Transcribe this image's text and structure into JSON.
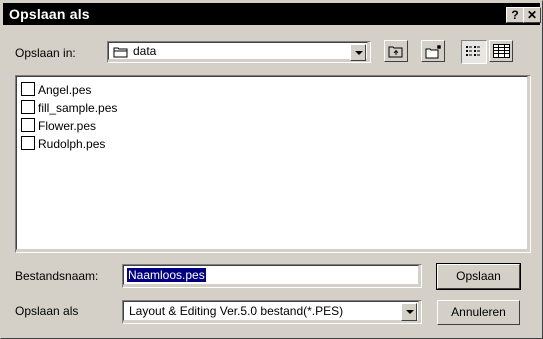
{
  "window": {
    "title": "Opslaan als",
    "help_label": "?",
    "close_label": "✕"
  },
  "location": {
    "label": "Opslaan in:",
    "value": "data"
  },
  "files": [
    {
      "name": "Angel.pes"
    },
    {
      "name": "fill_sample.pes"
    },
    {
      "name": "Flower.pes"
    },
    {
      "name": "Rudolph.pes"
    }
  ],
  "filename": {
    "label": "Bestandsnaam:",
    "value": "Naamloos.pes"
  },
  "filetype": {
    "label": "Opslaan als",
    "value": "Layout & Editing Ver.5.0 bestand(*.PES)"
  },
  "buttons": {
    "save": "Opslaan",
    "cancel": "Annuleren"
  },
  "toolbar": {
    "up_icon": "up-folder-icon",
    "new_folder_icon": "new-folder-icon",
    "list_icon": "list-view-icon",
    "details_icon": "details-view-icon"
  },
  "colors": {
    "titlebar": "#000000",
    "face": "#d4d0c8",
    "selection": "#000080"
  }
}
